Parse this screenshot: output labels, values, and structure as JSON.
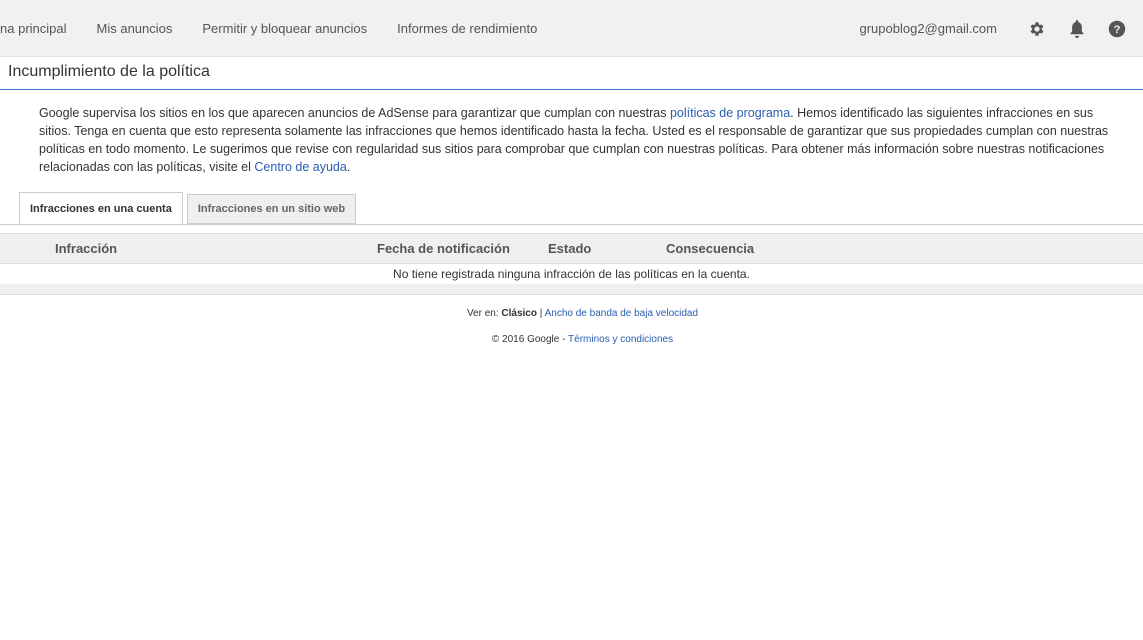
{
  "nav": {
    "items": [
      "Página principal",
      "Mis anuncios",
      "Permitir y bloquear anuncios",
      "Informes de rendimiento"
    ],
    "email": "grupoblog2@gmail.com",
    "icons": [
      "gear-icon",
      "bell-icon",
      "help-icon"
    ]
  },
  "page": {
    "title": "Incumplimiento de la política"
  },
  "description": {
    "part1": "Google supervisa los sitios en los que aparecen anuncios de AdSense para garantizar que cumplan con nuestras ",
    "link1": "políticas de programa",
    "part2": ". Hemos identificado las siguientes infracciones en sus sitios. Tenga en cuenta que esto representa solamente las infracciones que hemos identificado hasta la fecha. Usted es el responsable de garantizar que sus propiedades cumplan con nuestras políticas en todo momento. Le sugerimos que revise con regularidad sus sitios para comprobar que cumplan con nuestras políticas. Para obtener más información sobre nuestras notificaciones relacionadas con las políticas, visite el ",
    "link2": "Centro de ayuda",
    "part3": "."
  },
  "tabs": {
    "account": "Infracciones en una cuenta",
    "site": "Infracciones en un sitio web"
  },
  "table": {
    "headers": [
      "Infracción",
      "Fecha de notificación",
      "Estado",
      "Consecuencia"
    ],
    "empty_message": "No tiene registrada ninguna infracción de las políticas en la cuenta."
  },
  "footer": {
    "view_prefix": "Ver en: ",
    "classic": "Clásico",
    "separator": " | ",
    "low_bandwidth": "Ancho de banda de baja velocidad",
    "copyright": "© 2016 Google - ",
    "terms": "Términos y condiciones"
  },
  "colors": {
    "link": "#2a5db0",
    "title_rule": "#3c78d8",
    "topbar_bg": "#f1f1f1",
    "table_head_bg": "#efefef"
  }
}
